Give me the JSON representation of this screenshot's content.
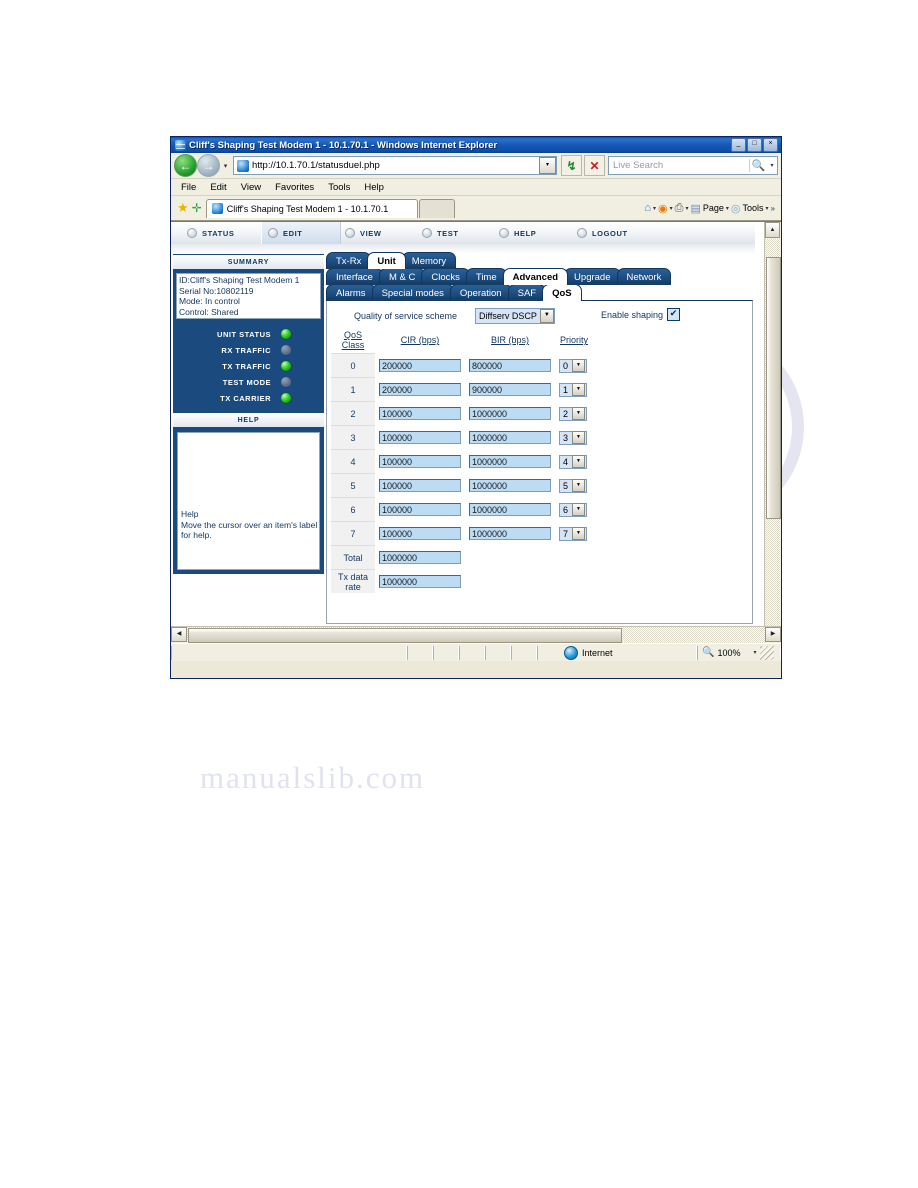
{
  "browser": {
    "title": "Cliff's Shaping Test Modem 1 - 10.1.70.1 - Windows Internet Explorer",
    "minimize_label": "_",
    "maximize_label": "□",
    "close_label": "×",
    "back_label": "←",
    "forward_label": "→",
    "nav_dropdown": "▾",
    "url": "http://10.1.70.1/statusduel.php",
    "url_dropdown": "▾",
    "refresh_label": "↯",
    "stop_label": "✕",
    "search_placeholder": "Live Search",
    "search_icon": "🔍",
    "search_dropdown": "▾",
    "menu": [
      "File",
      "Edit",
      "View",
      "Favorites",
      "Tools",
      "Help"
    ],
    "tab_title": "Cliff's Shaping Test Modem 1 - 10.1.70.1",
    "command_bar": {
      "home_icon": "⌂",
      "feeds_icon": "◉",
      "print_icon": "⎙",
      "page_label": "Page",
      "tools_label": "Tools",
      "overflow_label": "»",
      "caret": "▾"
    }
  },
  "status_bar": {
    "zone_label": "Internet",
    "zoom_label": "100%",
    "zoom_caret": "▾"
  },
  "top_nav": [
    {
      "label": "STATUS",
      "active": false
    },
    {
      "label": "EDIT",
      "active": true
    },
    {
      "label": "VIEW",
      "active": false
    },
    {
      "label": "TEST",
      "active": false
    },
    {
      "label": "HELP",
      "active": false
    },
    {
      "label": "LOGOUT",
      "active": false
    }
  ],
  "summary": {
    "header": "SUMMARY",
    "lines": [
      "ID:Cliff's Shaping Test Modem 1",
      "Serial No:10802119",
      "Mode: In control",
      "Control: Shared"
    ],
    "leds": [
      {
        "label": "UNIT STATUS",
        "state": "on"
      },
      {
        "label": "RX TRAFFIC",
        "state": "off"
      },
      {
        "label": "TX TRAFFIC",
        "state": "on"
      },
      {
        "label": "TEST MODE",
        "state": "off"
      },
      {
        "label": "TX CARRIER",
        "state": "on"
      }
    ]
  },
  "help_panel": {
    "header": "HELP",
    "title": "Help",
    "body": "Move the cursor over an item's label for help."
  },
  "tabs": {
    "row1": [
      {
        "label": "Tx-Rx",
        "selected": false
      },
      {
        "label": "Unit",
        "selected": true
      },
      {
        "label": "Memory",
        "selected": false
      }
    ],
    "row2": [
      {
        "label": "Interface",
        "selected": false
      },
      {
        "label": "M & C",
        "selected": false
      },
      {
        "label": "Clocks",
        "selected": false
      },
      {
        "label": "Time",
        "selected": false
      },
      {
        "label": "Advanced",
        "selected": true
      },
      {
        "label": "Upgrade",
        "selected": false
      },
      {
        "label": "Network",
        "selected": false
      }
    ],
    "row3": [
      {
        "label": "Alarms",
        "selected": false
      },
      {
        "label": "Special modes",
        "selected": false
      },
      {
        "label": "Operation",
        "selected": false
      },
      {
        "label": "SAF",
        "selected": false
      },
      {
        "label": "QoS",
        "selected": true
      }
    ]
  },
  "qos": {
    "scheme_label": "Quality of service scheme",
    "scheme_value": "Diffserv DSCP",
    "scheme_caret": "▼",
    "enable_shaping_label": "Enable shaping",
    "enable_shaping_checked": true,
    "checkmark": "✔",
    "headers": {
      "class": "QoS Class",
      "class_line1": "QoS",
      "class_line2": "Class",
      "cir": "CIR (bps)",
      "bir": "BIR (bps)",
      "priority": "Priority"
    },
    "rows": [
      {
        "class": "0",
        "cir": "200000",
        "bir": "800000",
        "priority": "0"
      },
      {
        "class": "1",
        "cir": "200000",
        "bir": "900000",
        "priority": "1"
      },
      {
        "class": "2",
        "cir": "100000",
        "bir": "1000000",
        "priority": "2"
      },
      {
        "class": "3",
        "cir": "100000",
        "bir": "1000000",
        "priority": "3"
      },
      {
        "class": "4",
        "cir": "100000",
        "bir": "1000000",
        "priority": "4"
      },
      {
        "class": "5",
        "cir": "100000",
        "bir": "1000000",
        "priority": "5"
      },
      {
        "class": "6",
        "cir": "100000",
        "bir": "1000000",
        "priority": "6"
      },
      {
        "class": "7",
        "cir": "100000",
        "bir": "1000000",
        "priority": "7"
      }
    ],
    "total_label": "Total",
    "total_value": "1000000",
    "txrate_label_line1": "Tx data",
    "txrate_label_line2": "rate",
    "txrate_value": "1000000",
    "priority_caret": "▼"
  },
  "scroll": {
    "up_arrow": "▲",
    "down_arrow": "▼",
    "left_arrow": "◀",
    "right_arrow": "▶"
  }
}
